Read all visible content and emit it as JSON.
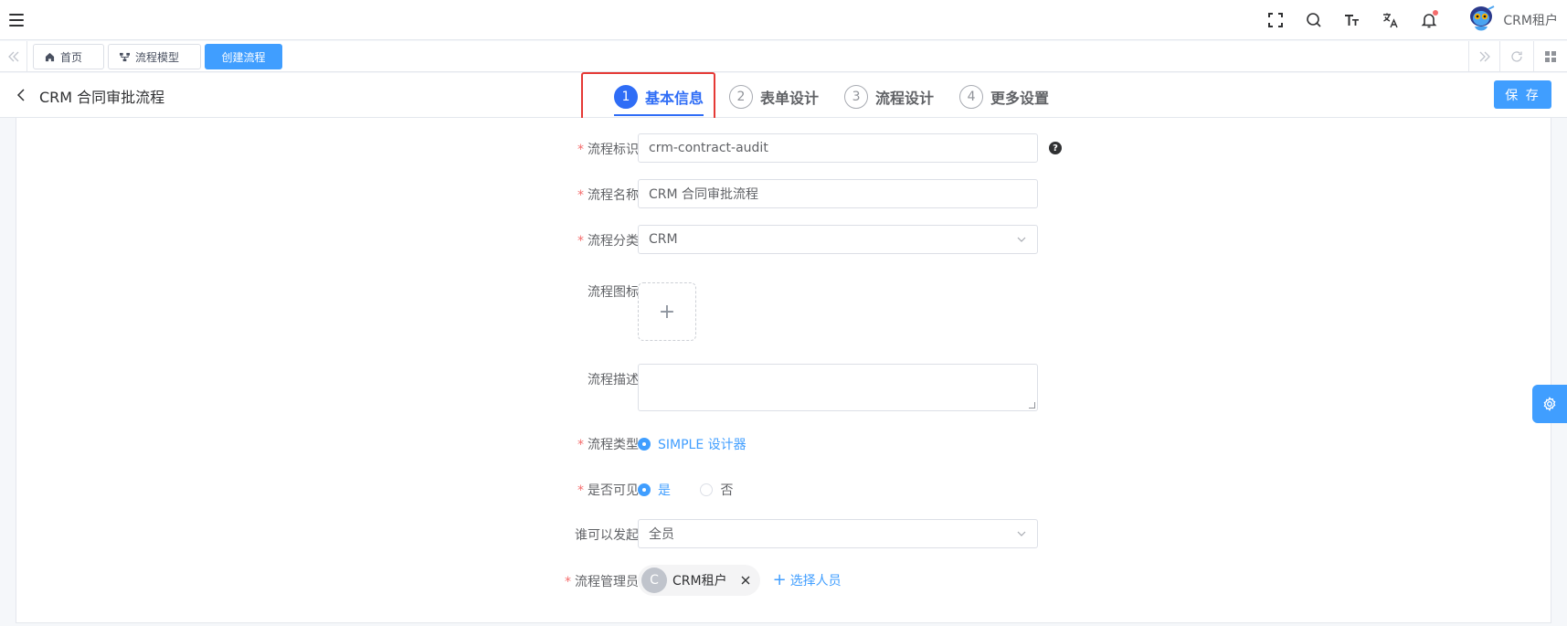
{
  "navbar": {
    "user_name": "CRM租户",
    "icons": [
      "menu-icon",
      "fullscreen-icon",
      "search-icon",
      "font-size-icon",
      "translate-icon",
      "bell-icon"
    ]
  },
  "tags": [
    {
      "label": "首页",
      "icon": "home-icon",
      "active": false
    },
    {
      "label": "流程模型",
      "icon": "flow-icon",
      "active": false
    },
    {
      "label": "创建流程",
      "icon": "",
      "active": true
    }
  ],
  "header": {
    "title": "CRM 合同审批流程",
    "save_label": "保 存",
    "steps": [
      {
        "num": "1",
        "label": "基本信息",
        "active": true
      },
      {
        "num": "2",
        "label": "表单设计",
        "active": false
      },
      {
        "num": "3",
        "label": "流程设计",
        "active": false
      },
      {
        "num": "4",
        "label": "更多设置",
        "active": false
      }
    ]
  },
  "form": {
    "key": {
      "label": "流程标识",
      "required": "*",
      "value": "crm-contract-audit",
      "help": "?"
    },
    "name": {
      "label": "流程名称",
      "required": "*",
      "value": "CRM 合同审批流程"
    },
    "category": {
      "label": "流程分类",
      "required": "*",
      "value": "CRM"
    },
    "icon": {
      "label": "流程图标",
      "upload_symbol": "+"
    },
    "description": {
      "label": "流程描述",
      "value": ""
    },
    "type": {
      "label": "流程类型",
      "required": "*",
      "option": "SIMPLE 设计器"
    },
    "visible": {
      "label": "是否可见",
      "required": "*",
      "yes": "是",
      "no": "否"
    },
    "starter": {
      "label": "谁可以发起",
      "value": "全员"
    },
    "managers": {
      "label": "流程管理员",
      "required": "*",
      "user_initial": "C",
      "user_name": "CRM租户",
      "add_label": "选择人员",
      "add_symbol": "+"
    }
  },
  "colors": {
    "primary": "#409eff",
    "step_active": "#2f6df6",
    "highlight": "#e53935",
    "required": "#f56c6c"
  }
}
